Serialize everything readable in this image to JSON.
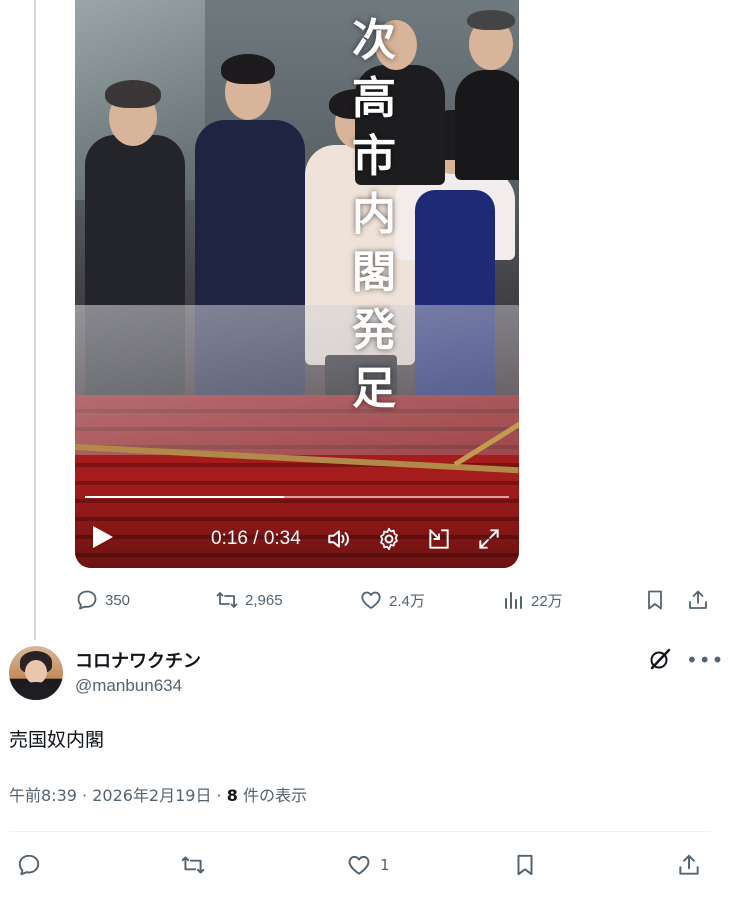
{
  "video": {
    "overlay_text": [
      "次",
      "高",
      "市",
      "内",
      "閣",
      "発",
      "足"
    ],
    "time_current": "0:16",
    "time_total": "0:34",
    "progress_fraction": 0.47
  },
  "parent_actions": {
    "replies": "350",
    "reposts": "2,965",
    "likes": "2.4万",
    "views": "22万"
  },
  "reply": {
    "display_name": "コロナワクチン",
    "handle": "@manbun634",
    "text": "売国奴内閣",
    "time": "午前8:39",
    "date": "2026年2月19日",
    "view_count": "8",
    "view_label": "件の表示",
    "likes": "1"
  },
  "colors": {
    "text_primary": "#0f1419",
    "text_secondary": "#536471",
    "thread_line": "#cfd9de"
  }
}
